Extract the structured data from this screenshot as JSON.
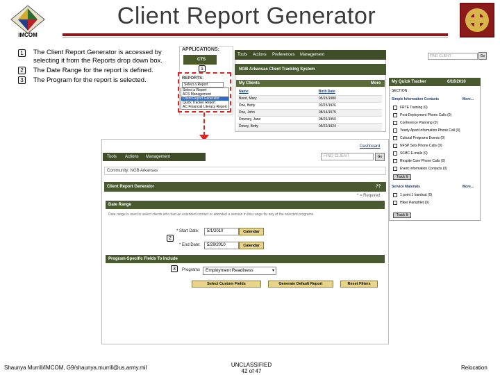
{
  "header": {
    "title": "Client Report Generator",
    "logo_left_text": "IMCOM"
  },
  "steps": [
    {
      "num": "1",
      "text": "The Client Report Generator is accessed by selecting it from the Reports drop down box."
    },
    {
      "num": "2",
      "text": "The Date Range for the report is defined."
    },
    {
      "num": "3",
      "text": "The Program for the report is selected."
    }
  ],
  "apps": {
    "title": "APPLICATIONS:",
    "cts": "CTS",
    "reports_title": "REPORTS:",
    "select_value": "Select a Report",
    "report_options": [
      "Select a Report",
      "ACS Management",
      "Client Report Generator",
      "Quick Tracker Report",
      "AC Financial Literacy Report"
    ]
  },
  "app1": {
    "nav": [
      "Tools",
      "Actions",
      "Preferences",
      "Management"
    ],
    "search_placeholder": "FIND CLIENT",
    "go": "Go",
    "system_title": "NGB Arkansas Client Tracking System",
    "my_clients": "My Clients",
    "more": "More",
    "columns": [
      "Name",
      "Birth Date"
    ],
    "rows": [
      [
        "Bond, Mary",
        "05/15/1980"
      ],
      [
        "Doe, Betty",
        "03/23/1926"
      ],
      [
        "Doe, John",
        "08/14/1975"
      ],
      [
        "Downey, Jane",
        "08/25/1950"
      ],
      [
        "Dowry, Betty",
        "05/22/1924"
      ]
    ]
  },
  "quick": {
    "title": "My Quick Tracker",
    "date": "6/16/2010",
    "section_label": "SECTION",
    "simple_contacts": "Simple Information Contacts",
    "more": "More...",
    "items": [
      "FRTE Training (0)",
      "Post-Deployment Phone Calls (0)",
      "Conference Planning (0)",
      "Yearly Apart Information Phone Call (0)",
      "Cultural Programs Events (0)",
      "NFSP Sets Phone Calls (0)",
      "SFMC E-mails (0)",
      "Respite Care Phone Calls (0)",
      "Event Information Contacts (0)"
    ],
    "track_btn": "Track It",
    "service_materials": "Service Materials",
    "materials": [
      "1 point 1 handout (0)",
      "Hiker Pamphlet (0)"
    ],
    "track_btn2": "Track It"
  },
  "gen": {
    "dashboard": "Dashboard",
    "nav": [
      "Tools",
      "Actions",
      "Management"
    ],
    "search_placeholder": "FIND CLIENT",
    "go": "Go",
    "community": "Community: NGB Arkansas",
    "title": "Client Report Generator",
    "help": "??",
    "required": "* = Required",
    "date_range": "Date Range",
    "date_desc": "Date range is used to select clients who had an extended contact or attended a session in this range for any of the selected programs.",
    "start_label": "* Start Date:",
    "start_value": "5/1/2010",
    "end_label": "* End Date:",
    "end_value": "5/29/2010",
    "calendar": "Calendar",
    "psf_title": "Program-Specific Fields To Include",
    "programs_label": "Programs",
    "program_value": "Employment Readiness",
    "btn_custom": "Select Custom Fields",
    "btn_default": "Generate Default Report",
    "btn_reset": "Reset Filters",
    "marker_1": "1",
    "marker_2": "2",
    "marker_3": "3"
  },
  "footer": {
    "left": "Shaunya Murrill/IMCOM, G9/shaunya.murrill@us.army.mil",
    "classification": "UNCLASSIFIED",
    "page": "42 of 47",
    "right": "Relocation"
  },
  "colors": {
    "accent_red": "#d22222",
    "olive_bar": "#4a5a30",
    "title_rule": "#8b1a1a"
  }
}
